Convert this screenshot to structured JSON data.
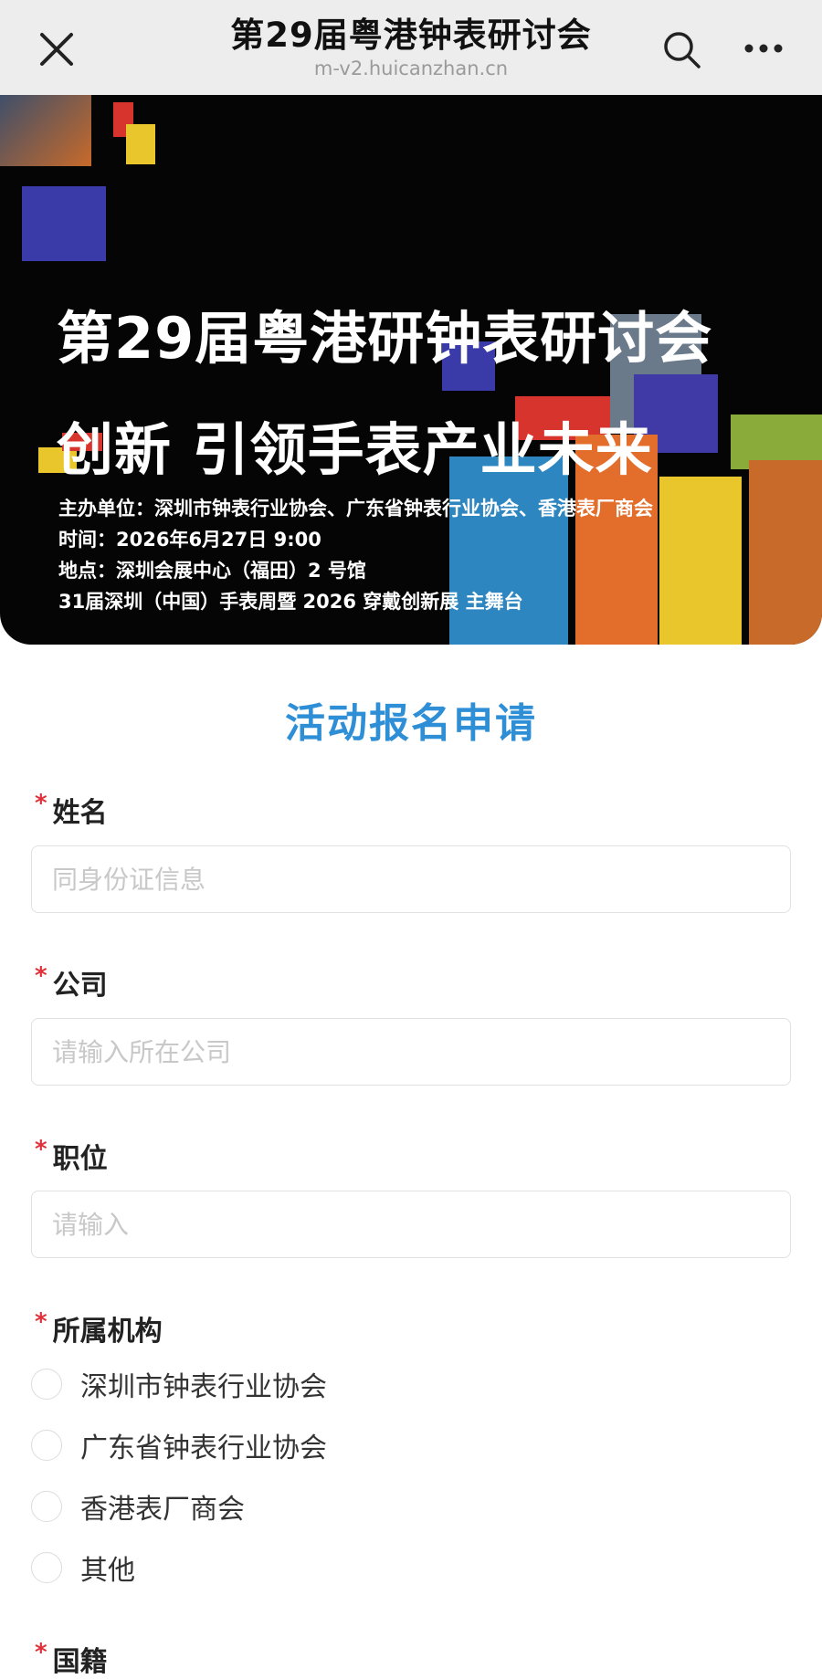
{
  "header": {
    "title": "第29届粤港钟表研讨会",
    "url": "m-v2.huicanzhan.cn",
    "icons": [
      "close-icon",
      "search-icon",
      "more-icon"
    ]
  },
  "banner": {
    "title": "第29届粤港研钟表研讨会",
    "subtitle": "创新 引领手表产业未来",
    "info": {
      "organizer": "主办单位：深圳市钟表行业协会、广东省钟表行业协会、香港表厂商会",
      "time": "时间：2026年6月27日 9:00",
      "location": "地点：深圳会展中心（福田）2 号馆",
      "event": "31届深圳（中国）手表周暨 2026 穿戴创新展 主舞台"
    }
  },
  "form": {
    "title": "活动报名申请",
    "required_mark": "*",
    "fields": {
      "name": {
        "label": "姓名",
        "placeholder": "同身份证信息",
        "value": ""
      },
      "company": {
        "label": "公司",
        "placeholder": "请输入所在公司",
        "value": ""
      },
      "position": {
        "label": "职位",
        "placeholder": "请输入",
        "value": ""
      },
      "organization": {
        "label": "所属机构",
        "options": [
          "深圳市钟表行业协会",
          "广东省钟表行业协会",
          "香港表厂商会",
          "其他"
        ]
      },
      "nationality": {
        "label": "国籍"
      }
    }
  },
  "colors": {
    "accent": "#2f8fd6",
    "required": "#e0303a",
    "topbar_bg": "#ededed",
    "banner_bg": "#050505"
  }
}
